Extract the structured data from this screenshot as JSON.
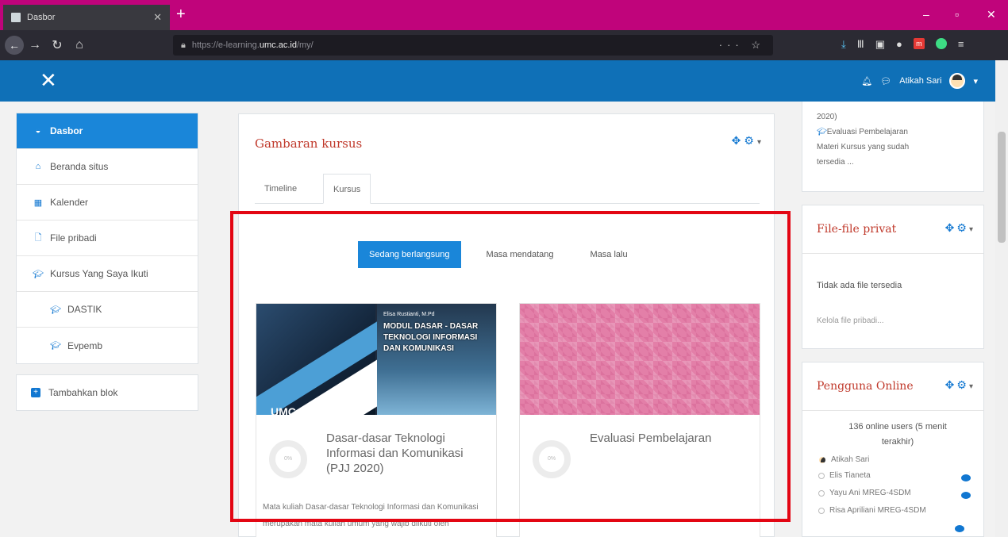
{
  "browser": {
    "tab_title": "Dasbor",
    "url_prefix": "https://e-learning.",
    "url_domain": "umc.ac.id",
    "url_path": "/my/"
  },
  "header": {
    "user_name": "Atikah Sari"
  },
  "sidebar": {
    "items": [
      {
        "label": "Dasbor",
        "icon": "dashboard-icon"
      },
      {
        "label": "Beranda situs",
        "icon": "home-icon"
      },
      {
        "label": "Kalender",
        "icon": "calendar-icon"
      },
      {
        "label": "File pribadi",
        "icon": "file-icon"
      },
      {
        "label": "Kursus Yang Saya Ikuti",
        "icon": "graduation-cap-icon"
      },
      {
        "label": "DASTIK",
        "icon": "graduation-cap-icon"
      },
      {
        "label": "Evpemb",
        "icon": "graduation-cap-icon"
      }
    ],
    "add_block": "Tambahkan blok"
  },
  "overview": {
    "title": "Gambaran kursus",
    "tabs": [
      "Timeline",
      "Kursus"
    ],
    "filters": [
      "Sedang berlangsung",
      "Masa mendatang",
      "Masa lalu"
    ],
    "courses": [
      {
        "name": "Dasar-dasar Teknologi Informasi dan Komunikasi (PJJ 2020)",
        "progress": "0%",
        "description": "Mata kuliah Dasar-dasar Teknologi Informasi dan Komunikasi merupakan mata kuliah umum yang wajib diikuti oleh",
        "image_title": "MODUL DASAR - DASAR TEKNOLOGI INFORMASI DAN KOMUNIKASI",
        "image_author": "Elisa Rustianti, M.Pd",
        "image_brand": "UMC"
      },
      {
        "name": "Evaluasi Pembelajaran",
        "progress": "0%"
      }
    ]
  },
  "right_blocks": {
    "recent": {
      "line1": "2020)",
      "course": "Evaluasi Pembelajaran",
      "desc1": "Materi Kursus yang sudah",
      "desc2": "tersedia ..."
    },
    "private_files": {
      "title": "File-file privat",
      "empty": "Tidak ada file tersedia",
      "manage": "Kelola file pribadi..."
    },
    "online_users": {
      "title": "Pengguna Online",
      "summary1": "136 online users (5 menit",
      "summary2": "terakhir)",
      "users": [
        "Atikah Sari",
        "Elis Tianeta",
        "Yayu Ani MREG-4SDM",
        "Risa Apriliani MREG-4SDM"
      ]
    }
  },
  "colors": {
    "brand_blue": "#0f70b7",
    "active_blue": "#1a86d9",
    "title_red": "#c0392b",
    "highlight_red": "#e30613",
    "tab_strip": "#c0047b"
  }
}
